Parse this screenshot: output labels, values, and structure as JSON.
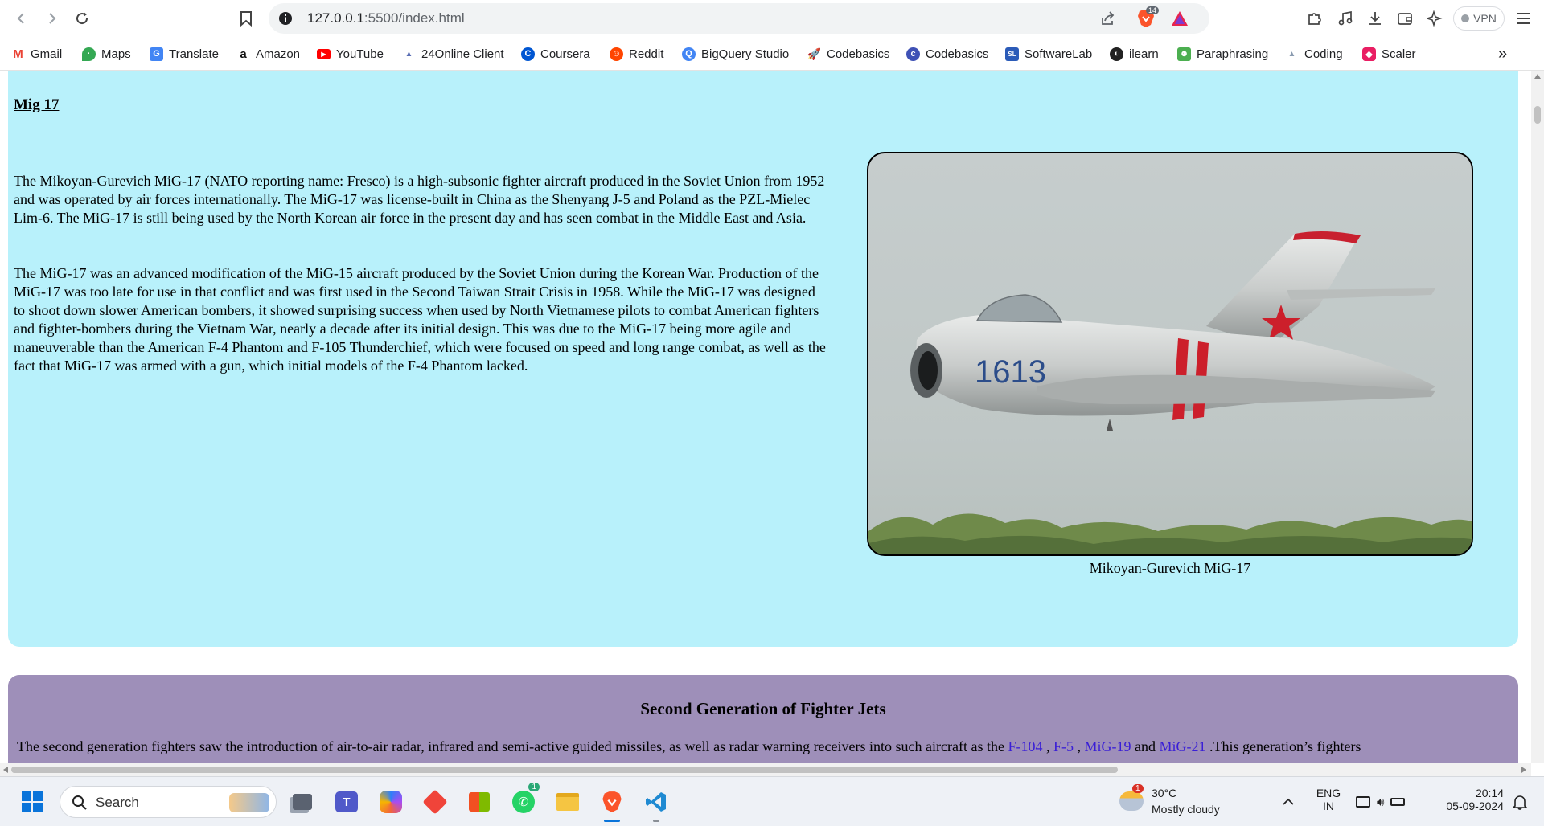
{
  "browser": {
    "url_host": "127.0.0.1",
    "url_path": ":5500/index.html",
    "shield_badge": "14",
    "vpn_label": "VPN"
  },
  "bookmarks": [
    {
      "label": "Gmail",
      "icon": "gmail-icon",
      "color": "#ea4335"
    },
    {
      "label": "Maps",
      "icon": "maps-icon",
      "color": "#34a853"
    },
    {
      "label": "Translate",
      "icon": "translate-icon",
      "color": "#4285f4"
    },
    {
      "label": "Amazon",
      "icon": "amazon-icon",
      "color": "#111111"
    },
    {
      "label": "YouTube",
      "icon": "youtube-icon",
      "color": "#ff0000"
    },
    {
      "label": "24Online Client",
      "icon": "24online-icon",
      "color": "#5b6fb5"
    },
    {
      "label": "Coursera",
      "icon": "coursera-icon",
      "color": "#0056d2"
    },
    {
      "label": "Reddit",
      "icon": "reddit-icon",
      "color": "#ff4500"
    },
    {
      "label": "BigQuery Studio",
      "icon": "bigquery-icon",
      "color": "#4285f4"
    },
    {
      "label": "Codebasics",
      "icon": "codebasics-rocket-icon",
      "color": "#6b5bd6"
    },
    {
      "label": "Codebasics",
      "icon": "codebasics-icon",
      "color": "#3f51b5"
    },
    {
      "label": "SoftwareLab",
      "icon": "softwarelab-icon",
      "color": "#2b5bb8"
    },
    {
      "label": "ilearn",
      "icon": "ilearn-icon",
      "color": "#222222"
    },
    {
      "label": "Paraphrasing",
      "icon": "paraphrasing-icon",
      "color": "#4caf50"
    },
    {
      "label": "Coding",
      "icon": "coding-icon",
      "color": "#8a9bb0"
    },
    {
      "label": "Scaler",
      "icon": "scaler-icon",
      "color": "#e91e63"
    }
  ],
  "section1": {
    "title": "Mig 17",
    "para1": "The Mikoyan-Gurevich MiG-17 (NATO reporting name: Fresco) is a high-subsonic fighter aircraft produced in the Soviet Union from 1952 and was operated by air forces internationally. The MiG-17 was license-built in China as the Shenyang J-5 and Poland as the PZL-Mielec Lim-6. The MiG-17 is still being used by the North Korean air force in the present day and has seen combat in the Middle East and Asia.",
    "para2": "The MiG-17 was an advanced modification of the MiG-15 aircraft produced by the Soviet Union during the Korean War. Production of the MiG-17 was too late for use in that conflict and was first used in the Second Taiwan Strait Crisis in 1958. While the MiG-17 was designed to shoot down slower American bombers, it showed surprising success when used by North Vietnamese pilots to combat American fighters and fighter-bombers during the Vietnam War, nearly a decade after its initial design. This was due to the MiG-17 being more agile and maneuverable than the American F-4 Phantom and F-105 Thunderchief, which were focused on speed and long range combat, as well as the fact that MiG-17 was armed with a gun, which initial models of the F-4 Phantom lacked.",
    "caption": "Mikoyan-Gurevich MiG-17",
    "tail_number": "1613"
  },
  "section2": {
    "title": "Second Generation of Fighter Jets",
    "text_before": "The second generation fighters saw the introduction of air-to-air radar, infrared and semi-active guided missiles, as well as radar warning receivers into such aircraft as the ",
    "link1": "F-104",
    "sep1": " , ",
    "link2": "F-5",
    "sep2": " , ",
    "link3": "MiG-19",
    "sep3": " and ",
    "link4": "MiG-21",
    "text_after": " .This generation’s fighters"
  },
  "taskbar": {
    "search_label": "Search",
    "whatsapp_badge": "1",
    "weather_temp": "30°C",
    "weather_desc": "Mostly cloudy",
    "weather_badge": "1",
    "lang_top": "ENG",
    "lang_bottom": "IN",
    "time": "20:14",
    "date": "05-09-2024"
  }
}
